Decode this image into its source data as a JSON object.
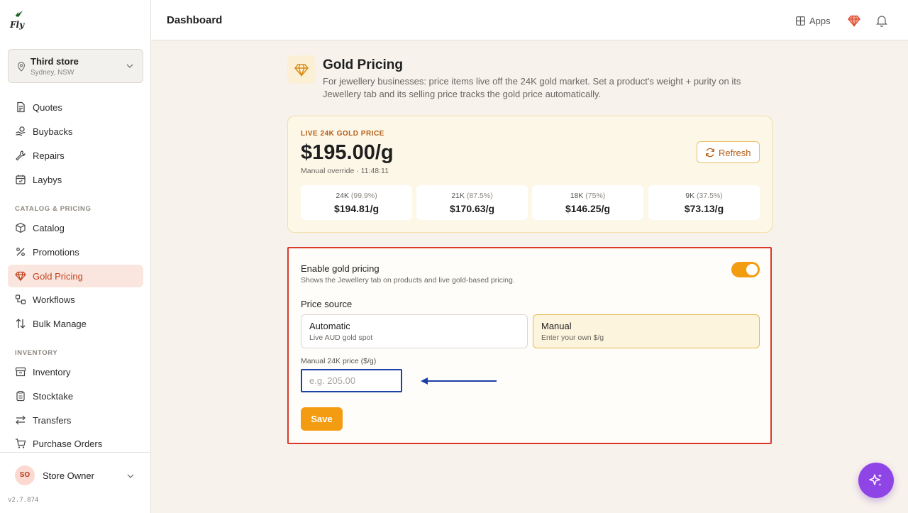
{
  "app": {
    "logo_text": "Fly",
    "version": "v2.7.874"
  },
  "store": {
    "name": "Third store",
    "location": "Sydney, NSW"
  },
  "sidebar": {
    "items_top": [
      {
        "label": "Quotes",
        "icon": "document-icon"
      },
      {
        "label": "Buybacks",
        "icon": "hand-coins-icon"
      },
      {
        "label": "Repairs",
        "icon": "wrench-icon"
      },
      {
        "label": "Laybys",
        "icon": "calendar-icon"
      }
    ],
    "section_catalog": "CATALOG & PRICING",
    "items_catalog": [
      {
        "label": "Catalog",
        "icon": "box-icon"
      },
      {
        "label": "Promotions",
        "icon": "percent-icon"
      },
      {
        "label": "Gold Pricing",
        "icon": "gem-icon",
        "active": true
      },
      {
        "label": "Workflows",
        "icon": "workflow-icon"
      },
      {
        "label": "Bulk Manage",
        "icon": "sort-arrows-icon"
      }
    ],
    "section_inventory": "INVENTORY",
    "items_inventory": [
      {
        "label": "Inventory",
        "icon": "archive-icon"
      },
      {
        "label": "Stocktake",
        "icon": "clipboard-icon"
      },
      {
        "label": "Transfers",
        "icon": "transfer-arrows-icon"
      },
      {
        "label": "Purchase Orders",
        "icon": "cart-icon"
      }
    ]
  },
  "user": {
    "initials": "SO",
    "name": "Store Owner"
  },
  "header": {
    "title": "Dashboard",
    "apps_label": "Apps"
  },
  "page": {
    "title": "Gold Pricing",
    "description": "For jewellery businesses: price items live off the 24K gold market. Set a product's weight + purity on its Jewellery tab and its selling price tracks the gold price automatically."
  },
  "live_price": {
    "label": "LIVE 24K GOLD PRICE",
    "value": "$195.00/g",
    "sub": "Manual override · 11:48:11",
    "refresh_label": "Refresh",
    "karats": [
      {
        "karat": "24K",
        "purity": "(99.9%)",
        "price": "$194.81/g"
      },
      {
        "karat": "21K",
        "purity": "(87.5%)",
        "price": "$170.63/g"
      },
      {
        "karat": "18K",
        "purity": "(75%)",
        "price": "$146.25/g"
      },
      {
        "karat": "9K",
        "purity": "(37.5%)",
        "price": "$73.13/g"
      }
    ]
  },
  "settings": {
    "enable_title": "Enable gold pricing",
    "enable_sub": "Shows the Jewellery tab on products and live gold-based pricing.",
    "enabled": true,
    "price_source_title": "Price source",
    "options": [
      {
        "title": "Automatic",
        "sub": "Live AUD gold spot",
        "selected": false
      },
      {
        "title": "Manual",
        "sub": "Enter your own $/g",
        "selected": true
      }
    ],
    "manual_label": "Manual 24K price ($/g)",
    "manual_value": "",
    "manual_placeholder": "e.g. 205.00",
    "save_label": "Save"
  },
  "colors": {
    "accent": "#f39c12",
    "active_nav": "#c2411c",
    "highlight_border": "#d93a2b",
    "input_border": "#1d3fa8",
    "fab": "#8f45e6"
  }
}
